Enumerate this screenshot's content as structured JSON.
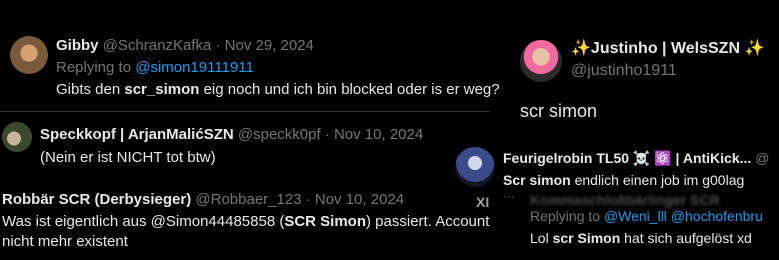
{
  "tweets": {
    "gibby": {
      "display_name": "Gibby",
      "handle": "@SchranzKafka",
      "date": "· Nov 29, 2024",
      "replying_to_prefix": "Replying to ",
      "replying_to_handle": "@simon19111911",
      "body_pre": "Gibts den ",
      "body_bold": "scr_simon",
      "body_post": " eig noch und ich bin blocked oder is er weg?"
    },
    "speckkopf": {
      "display_name": "Speckkopf | ArjanMalićSZN",
      "handle": "@speckk0pf",
      "date": "· Nov 10, 2024",
      "body": "(Nein er ist NICHT tot btw)"
    },
    "robbaer": {
      "display_name": "Robbär SCR (Derbysieger)",
      "handle": "@Robbaer_123",
      "date": "· Nov 10, 2024",
      "body_line1_pre": "Was ist eigentlich aus @Simon44485858 (",
      "body_line1_bold": "SCR Simon",
      "body_line1_post": ") passiert. Account",
      "body_line2": "nicht mehr existent"
    },
    "justinho": {
      "display_name": "✨Justinho | WelsSZN ✨",
      "handle": "@justinho1911",
      "body": "scr simon"
    },
    "feuerigel": {
      "display_name": "Feurigelrobin TL50 ☠️ ⚛️ | AntiKick...",
      "overflow_char": "@",
      "body_bold": "Scr simon",
      "body_post": " endlich einen job im g00lag",
      "hidden_name_fragment": "Kommaschloßbärlinger SCR",
      "hidden_xi": "XI",
      "replying_to_prefix": "Replying to ",
      "replying_to_handles": "@Weni_lll @hochofenbru",
      "reply_body_pre": "Lol ",
      "reply_body_bold": "scr Simon",
      "reply_body_post": " hat sich aufgelöst xd"
    }
  }
}
